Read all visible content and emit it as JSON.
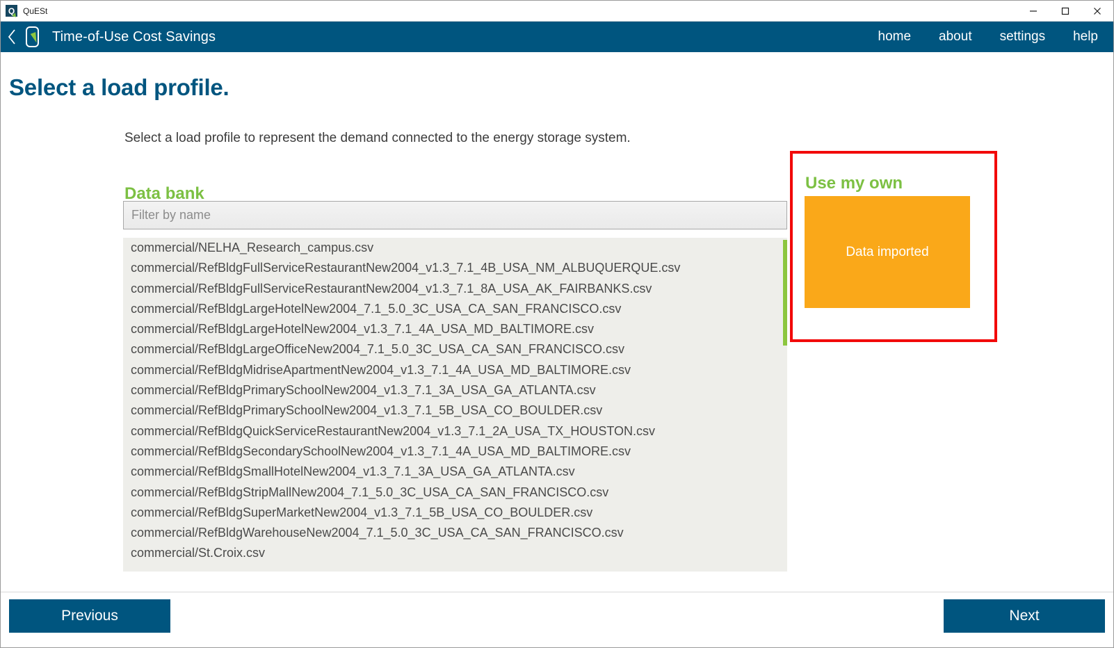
{
  "titlebar": {
    "app_name": "QuESt",
    "icon": "quest-app-icon",
    "minimize": "minimize-icon",
    "maximize": "maximize-icon",
    "close": "close-icon"
  },
  "appbar": {
    "back_icon": "back-chevron-icon",
    "logo": "quest-logo-icon",
    "title": "Time-of-Use Cost Savings",
    "nav": [
      {
        "label": "home"
      },
      {
        "label": "about"
      },
      {
        "label": "settings"
      },
      {
        "label": "help"
      }
    ]
  },
  "page": {
    "title": "Select a load profile.",
    "subtitle": "Select a load profile to represent the demand connected to the energy storage system."
  },
  "databank": {
    "heading": "Data bank",
    "filter_placeholder": "Filter by name",
    "filter_value": "",
    "items": [
      "commercial/NELHA_Research_campus.csv",
      "commercial/RefBldgFullServiceRestaurantNew2004_v1.3_7.1_4B_USA_NM_ALBUQUERQUE.csv",
      "commercial/RefBldgFullServiceRestaurantNew2004_v1.3_7.1_8A_USA_AK_FAIRBANKS.csv",
      "commercial/RefBldgLargeHotelNew2004_7.1_5.0_3C_USA_CA_SAN_FRANCISCO.csv",
      "commercial/RefBldgLargeHotelNew2004_v1.3_7.1_4A_USA_MD_BALTIMORE.csv",
      "commercial/RefBldgLargeOfficeNew2004_7.1_5.0_3C_USA_CA_SAN_FRANCISCO.csv",
      "commercial/RefBldgMidriseApartmentNew2004_v1.3_7.1_4A_USA_MD_BALTIMORE.csv",
      "commercial/RefBldgPrimarySchoolNew2004_v1.3_7.1_3A_USA_GA_ATLANTA.csv",
      "commercial/RefBldgPrimarySchoolNew2004_v1.3_7.1_5B_USA_CO_BOULDER.csv",
      "commercial/RefBldgQuickServiceRestaurantNew2004_v1.3_7.1_2A_USA_TX_HOUSTON.csv",
      "commercial/RefBldgSecondarySchoolNew2004_v1.3_7.1_4A_USA_MD_BALTIMORE.csv",
      "commercial/RefBldgSmallHotelNew2004_v1.3_7.1_3A_USA_GA_ATLANTA.csv",
      "commercial/RefBldgStripMallNew2004_7.1_5.0_3C_USA_CA_SAN_FRANCISCO.csv",
      "commercial/RefBldgSuperMarketNew2004_v1.3_7.1_5B_USA_CO_BOULDER.csv",
      "commercial/RefBldgWarehouseNew2004_7.1_5.0_3C_USA_CA_SAN_FRANCISCO.csv",
      "commercial/St.Croix.csv"
    ]
  },
  "use_my_own": {
    "heading": "Use my own",
    "import_button_label": "Data imported"
  },
  "footer": {
    "previous_label": "Previous",
    "next_label": "Next"
  },
  "colors": {
    "brand_blue": "#00557f",
    "brand_green": "#7cc043",
    "accent_orange": "#faa819",
    "highlight_red": "#f20a0a",
    "list_background": "#eeeeea"
  }
}
